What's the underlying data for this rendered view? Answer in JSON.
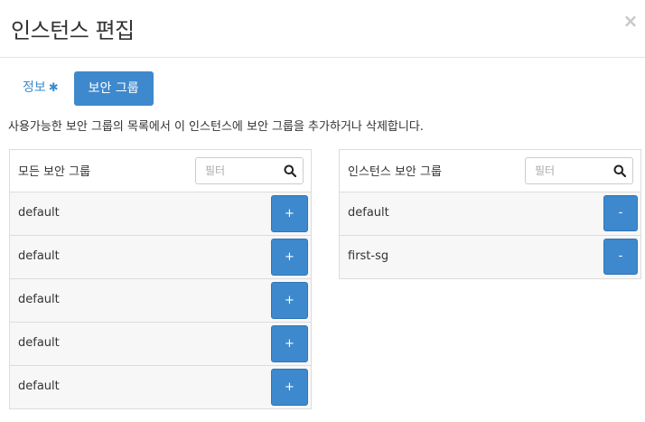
{
  "modal": {
    "title": "인스턴스 편집",
    "close_label": "×"
  },
  "tabs": [
    {
      "label": "정보",
      "required_mark": "✱",
      "active": false
    },
    {
      "label": "보안 그룹",
      "active": true
    }
  ],
  "help_text": "사용가능한 보안 그룹의 목록에서 이 인스턴스에 보안 그룹을 추가하거나 삭제합니다.",
  "available": {
    "title": "모든 보안 그룹",
    "filter_placeholder": "필터",
    "items": [
      {
        "name": "default",
        "action": "+"
      },
      {
        "name": "default",
        "action": "+"
      },
      {
        "name": "default",
        "action": "+"
      },
      {
        "name": "default",
        "action": "+"
      },
      {
        "name": "default",
        "action": "+"
      }
    ]
  },
  "selected": {
    "title": "인스턴스 보안 그룹",
    "filter_placeholder": "필터",
    "items": [
      {
        "name": "default",
        "action": "-"
      },
      {
        "name": "first-sg",
        "action": "-"
      }
    ]
  },
  "colors": {
    "accent": "#3e89cd",
    "link": "#3b8ccc",
    "row_bg": "#f7f7f7",
    "border": "#dcdcdc"
  },
  "icons": {
    "close": "close-icon",
    "search": "search-icon",
    "required": "asterisk-icon"
  }
}
